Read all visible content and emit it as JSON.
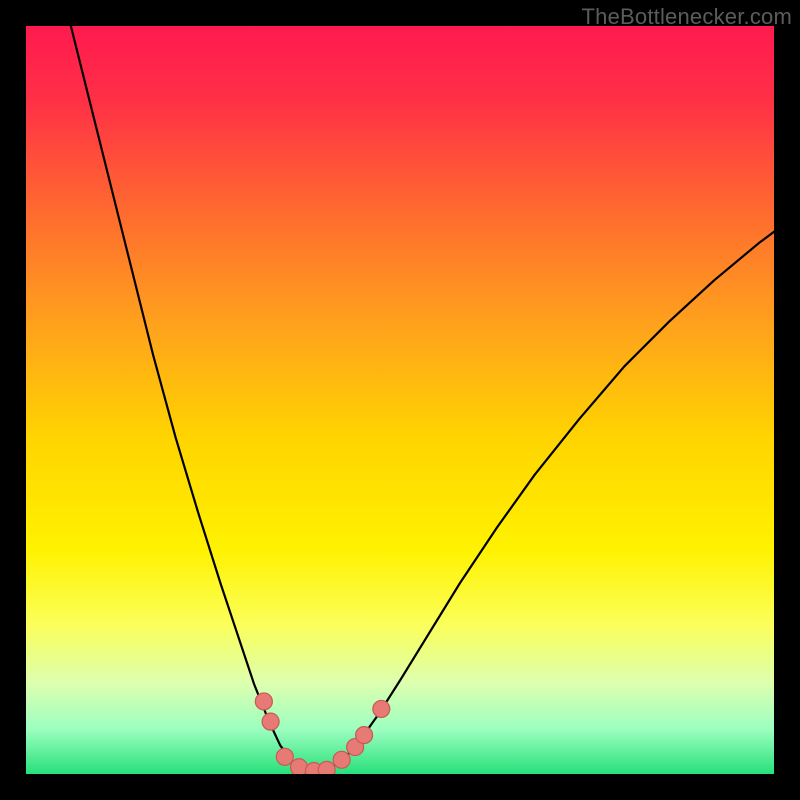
{
  "watermark": {
    "label": "TheBottlenecker.com"
  },
  "chart_data": {
    "type": "line",
    "title": "",
    "xlabel": "",
    "ylabel": "",
    "xlim": [
      0,
      100
    ],
    "ylim": [
      0,
      100
    ],
    "background_gradient": {
      "stops": [
        {
          "offset": 0.0,
          "color": "#ff1a4f"
        },
        {
          "offset": 0.1,
          "color": "#ff3046"
        },
        {
          "offset": 0.25,
          "color": "#ff6b2f"
        },
        {
          "offset": 0.4,
          "color": "#ffa21c"
        },
        {
          "offset": 0.55,
          "color": "#ffd400"
        },
        {
          "offset": 0.7,
          "color": "#fff200"
        },
        {
          "offset": 0.8,
          "color": "#fbff5a"
        },
        {
          "offset": 0.88,
          "color": "#dcffb0"
        },
        {
          "offset": 0.94,
          "color": "#9cffc0"
        },
        {
          "offset": 1.0,
          "color": "#27e07a"
        }
      ]
    },
    "curve": {
      "color": "#000000",
      "width": 2.2,
      "points": [
        {
          "x": 6.0,
          "y": 100.0
        },
        {
          "x": 8.0,
          "y": 92.0
        },
        {
          "x": 11.0,
          "y": 80.0
        },
        {
          "x": 14.0,
          "y": 68.0
        },
        {
          "x": 17.0,
          "y": 56.0
        },
        {
          "x": 20.0,
          "y": 45.0
        },
        {
          "x": 23.0,
          "y": 35.0
        },
        {
          "x": 26.0,
          "y": 25.5
        },
        {
          "x": 28.5,
          "y": 18.0
        },
        {
          "x": 30.5,
          "y": 12.0
        },
        {
          "x": 32.5,
          "y": 7.0
        },
        {
          "x": 34.0,
          "y": 3.8
        },
        {
          "x": 35.5,
          "y": 1.8
        },
        {
          "x": 37.0,
          "y": 0.8
        },
        {
          "x": 38.5,
          "y": 0.4
        },
        {
          "x": 40.0,
          "y": 0.45
        },
        {
          "x": 42.0,
          "y": 1.6
        },
        {
          "x": 44.0,
          "y": 3.6
        },
        {
          "x": 47.0,
          "y": 7.8
        },
        {
          "x": 50.0,
          "y": 12.5
        },
        {
          "x": 54.0,
          "y": 19.0
        },
        {
          "x": 58.0,
          "y": 25.5
        },
        {
          "x": 63.0,
          "y": 33.0
        },
        {
          "x": 68.0,
          "y": 40.0
        },
        {
          "x": 74.0,
          "y": 47.5
        },
        {
          "x": 80.0,
          "y": 54.5
        },
        {
          "x": 86.0,
          "y": 60.5
        },
        {
          "x": 92.0,
          "y": 66.0
        },
        {
          "x": 98.0,
          "y": 71.0
        },
        {
          "x": 100.0,
          "y": 72.5
        }
      ]
    },
    "markers": {
      "color": "#e77a74",
      "stroke": "#c85a54",
      "radius": 8.5,
      "points": [
        {
          "x": 31.8,
          "y": 9.7
        },
        {
          "x": 32.7,
          "y": 7.0
        },
        {
          "x": 34.6,
          "y": 2.3
        },
        {
          "x": 36.5,
          "y": 0.9
        },
        {
          "x": 38.5,
          "y": 0.4
        },
        {
          "x": 40.2,
          "y": 0.55
        },
        {
          "x": 42.2,
          "y": 1.9
        },
        {
          "x": 44.0,
          "y": 3.6
        },
        {
          "x": 45.2,
          "y": 5.2
        },
        {
          "x": 47.5,
          "y": 8.7
        }
      ]
    }
  }
}
